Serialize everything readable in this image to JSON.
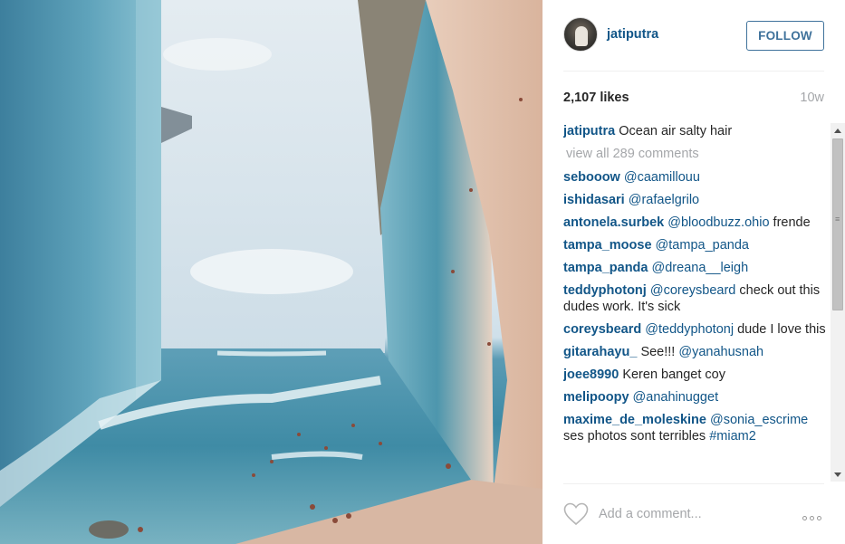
{
  "post": {
    "username": "jatiputra",
    "follow_label": "FOLLOW",
    "likes": "2,107 likes",
    "time": "10w",
    "caption_user": "jatiputra",
    "caption_text": "Ocean air salty hair",
    "view_all": "view all 289 comments"
  },
  "comments": [
    {
      "user": "sebooow",
      "mention": "@caamillouu",
      "text": ""
    },
    {
      "user": "ishidasari",
      "mention": "@rafaelgrilo",
      "text": ""
    },
    {
      "user": "antonela.surbek",
      "mention": "@bloodbuzz.ohio",
      "text": "frende"
    },
    {
      "user": "tampa_moose",
      "mention": "@tampa_panda",
      "text": ""
    },
    {
      "user": "tampa_panda",
      "mention": "@dreana__leigh",
      "text": ""
    },
    {
      "user": "teddyphotonj",
      "mention": "@coreysbeard",
      "text": "check out this dudes work. It's sick"
    },
    {
      "user": "coreysbeard",
      "mention": "@teddyphotonj",
      "text": "dude I love this"
    },
    {
      "user": "gitarahayu_",
      "mention": "",
      "text": "See!!!",
      "mention_after": "@yanahusnah"
    },
    {
      "user": "joee8990",
      "mention": "",
      "text": "Keren banget coy"
    },
    {
      "user": "melipoopy",
      "mention": "@anahinugget",
      "text": ""
    },
    {
      "user": "maxime_de_moleskine",
      "mention": "@sonia_escrime",
      "text": "ses photos sont terribles",
      "hashtag": "#miam2"
    }
  ],
  "footer": {
    "comment_placeholder": "Add a comment..."
  },
  "icons": {
    "like": "heart-icon",
    "more": "more-options-icon",
    "scroll_up": "scroll-up-arrow-icon",
    "scroll_down": "scroll-down-arrow-icon"
  },
  "colors": {
    "link": "#125688",
    "follow": "#3f729b",
    "muted": "#a5a7aa"
  }
}
